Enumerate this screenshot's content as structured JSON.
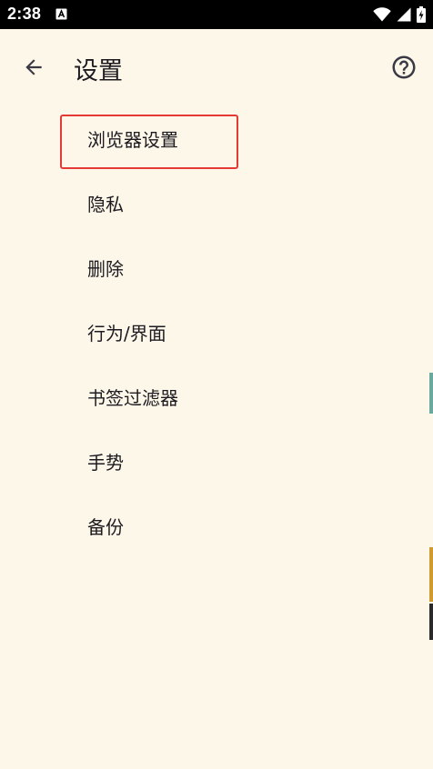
{
  "status_bar": {
    "time": "2:38",
    "notification_icon": "a11y-notification-icon",
    "wifi_icon": "wifi-icon",
    "signal_icon": "cell-signal-icon",
    "battery_icon": "battery-charging-icon"
  },
  "app_bar": {
    "title": "设置",
    "back_icon": "arrow-back-icon",
    "help_icon": "help-circle-icon"
  },
  "menu": {
    "items": [
      {
        "label": "浏览器设置"
      },
      {
        "label": "隐私"
      },
      {
        "label": "删除"
      },
      {
        "label": "行为/界面"
      },
      {
        "label": "书签过滤器"
      },
      {
        "label": "手势"
      },
      {
        "label": "备份"
      }
    ]
  },
  "colors": {
    "background": "#fdf7ea",
    "text": "#1d1b20",
    "highlight_border": "#e53935",
    "status_bar": "#000000"
  }
}
